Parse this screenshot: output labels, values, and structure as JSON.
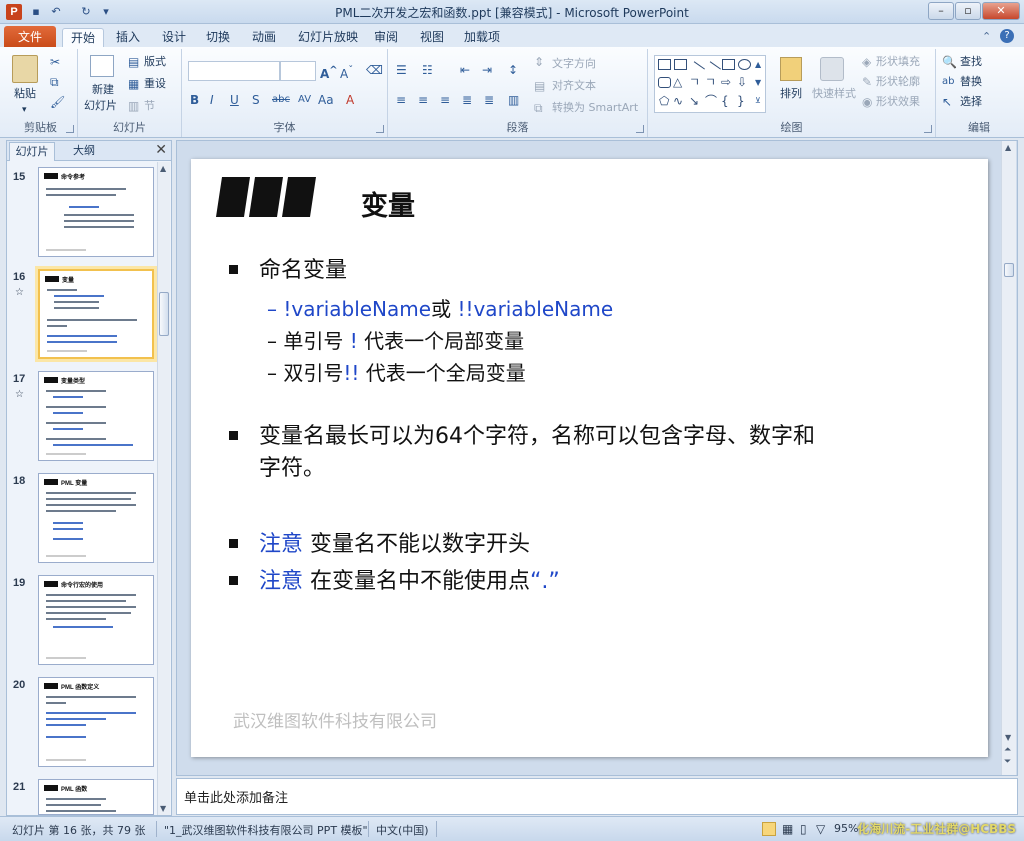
{
  "window": {
    "title": "PML二次开发之宏和函数.ppt [兼容模式] - Microsoft PowerPoint",
    "app_icon": "P"
  },
  "tabs": {
    "file": "文件",
    "items": [
      "开始",
      "插入",
      "设计",
      "切换",
      "动画",
      "幻灯片放映",
      "审阅",
      "视图",
      "加载项"
    ],
    "active": "开始"
  },
  "ribbon": {
    "clipboard": {
      "label": "剪贴板",
      "paste": "粘贴"
    },
    "slides": {
      "label": "幻灯片",
      "new_slide_1": "新建",
      "new_slide_2": "幻灯片",
      "layout": "版式",
      "reset": "重设",
      "section": "节"
    },
    "font": {
      "label": "字体"
    },
    "paragraph": {
      "label": "段落",
      "text_direction": "文字方向",
      "align_text": "对齐文本",
      "smartart": "转换为 SmartArt"
    },
    "drawing": {
      "label": "绘图",
      "arrange": "排列",
      "quick_styles": "快速样式",
      "shape_fill": "形状填充",
      "shape_outline": "形状轮廓",
      "shape_effects": "形状效果"
    },
    "editing": {
      "label": "编辑",
      "find": "查找",
      "replace": "替换",
      "select": "选择"
    }
  },
  "left_pane": {
    "tabs": [
      "幻灯片",
      "大纲"
    ],
    "close": "✕",
    "thumbnails": [
      {
        "number": "15",
        "title": "命令参考",
        "note": ""
      },
      {
        "number": "16",
        "title": "变量",
        "note": "☆",
        "selected": true
      },
      {
        "number": "17",
        "title": "变量类型",
        "note": "☆"
      },
      {
        "number": "18",
        "title": "PML 变量",
        "note": ""
      },
      {
        "number": "19",
        "title": "命令行宏的使用",
        "note": ""
      },
      {
        "number": "20",
        "title": "PML 函数定义",
        "note": ""
      },
      {
        "number": "21",
        "title": "PML 函数",
        "note": ""
      }
    ]
  },
  "slide": {
    "title": "变量",
    "bullet1": "命名变量",
    "sub1_blue_a": "!variableName",
    "sub1_black": "或 ",
    "sub1_blue_b": "!!variableName",
    "sub2_a": "单引号 ",
    "sub2_blue": "!",
    "sub2_b": " 代表一个局部变量",
    "sub3_a": "双引号",
    "sub3_blue": "!!",
    "sub3_b": " 代表一个全局变量",
    "bullet2_line1": "变量名最长可以为64个字符，名称可以包含字母、数字和",
    "bullet2_line2": "字符。",
    "bullet3_blue": "注意",
    "bullet3_text": "  变量名不能以数字开头",
    "bullet4_blue": "注意",
    "bullet4_text": "  在变量名中不能使用点",
    "bullet4_quote": "“.”",
    "footer": "武汉维图软件科技有限公司"
  },
  "notes": {
    "placeholder": "单击此处添加备注"
  },
  "status": {
    "slide_info": "幻灯片 第 16 张，共 79 张",
    "template": "\"1_武汉维图软件科技有限公司 PPT 模板\"",
    "language": "中文(中国)",
    "zoom": "95%",
    "watermark": "化海川流-工业社群@HCBBS"
  }
}
